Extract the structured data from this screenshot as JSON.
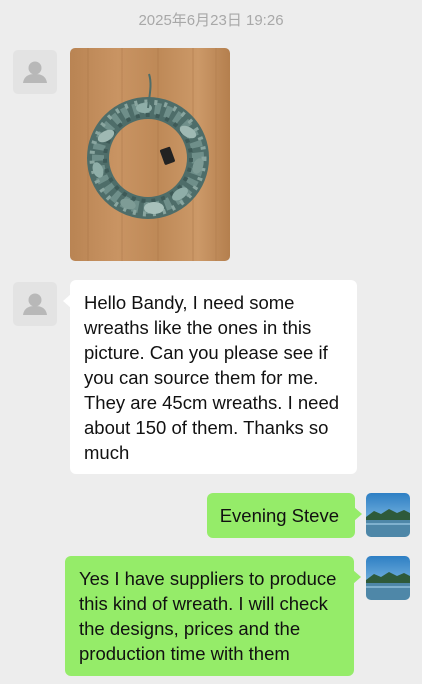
{
  "chat": {
    "timestamp": "2025年6月23日 19:26",
    "messages": [
      {
        "sender": "contact",
        "type": "image",
        "image": "wreath-photo"
      },
      {
        "sender": "contact",
        "type": "text",
        "text": "Hello Bandy, I need some wreaths like the ones in this picture. Can you please see if you can source them for me. They are 45cm wreaths. I need about 150 of them. Thanks so much"
      },
      {
        "sender": "self",
        "type": "text",
        "text": "Evening Steve"
      },
      {
        "sender": "self",
        "type": "text",
        "text": "Yes I have suppliers to produce this kind of wreath. I will check the designs, prices and the production time with them"
      }
    ]
  },
  "icons": {
    "contact_avatar": "default-person-icon",
    "self_avatar": "landscape-lake-icon"
  },
  "colors": {
    "background": "#EDEDED",
    "incoming_bubble": "#FFFFFF",
    "outgoing_bubble": "#95EC69",
    "timestamp_text": "#A8A8A8"
  }
}
